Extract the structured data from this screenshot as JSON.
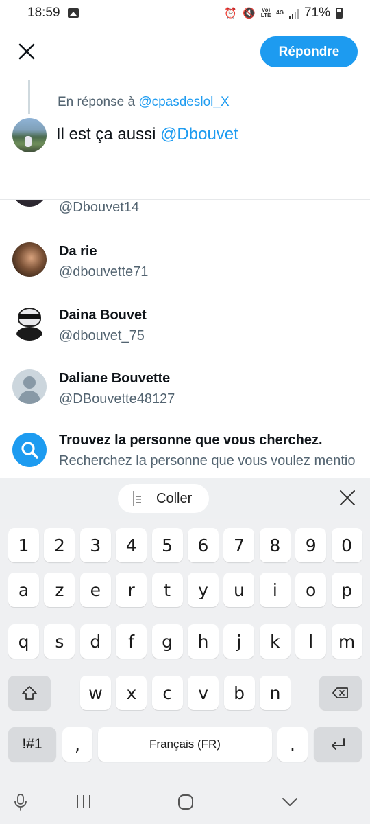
{
  "status_bar": {
    "time": "18:59",
    "network": "Vo)\nLTE",
    "network_gen": "4G",
    "battery": "71%"
  },
  "header": {
    "reply_button": "Répondre"
  },
  "compose": {
    "replying_prefix": "En réponse à ",
    "replying_handle": "@cpasdeslol_X",
    "text_before": "Il est ça aussi ",
    "text_mention": "@Dbouvet"
  },
  "suggestions": [
    {
      "name": "",
      "handle": "@Dbouvet14"
    },
    {
      "name": "Da rie",
      "handle": "@dbouvette71"
    },
    {
      "name": "Daina Bouvet",
      "handle": "@dbouvet_75"
    },
    {
      "name": "Daliane Bouvette",
      "handle": "@DBouvette48127"
    },
    {
      "name": "Trouvez la personne que vous cherchez.",
      "handle": "Recherchez la personne que vous voulez mentio"
    }
  ],
  "keyboard": {
    "paste_label": "Coller",
    "row_numbers": [
      "1",
      "2",
      "3",
      "4",
      "5",
      "6",
      "7",
      "8",
      "9",
      "0"
    ],
    "row1": [
      "a",
      "z",
      "e",
      "r",
      "t",
      "y",
      "u",
      "i",
      "o",
      "p"
    ],
    "row2": [
      "q",
      "s",
      "d",
      "f",
      "g",
      "h",
      "j",
      "k",
      "l",
      "m"
    ],
    "row3": [
      "w",
      "x",
      "c",
      "v",
      "b",
      "n"
    ],
    "symbols_key": "!#1",
    "comma_key": ",",
    "space_label": "Français (FR)",
    "period_key": "."
  },
  "colors": {
    "accent": "#1d9bf0",
    "text_primary": "#0f1419",
    "text_secondary": "#536471",
    "keyboard_bg": "#eff0f2"
  }
}
